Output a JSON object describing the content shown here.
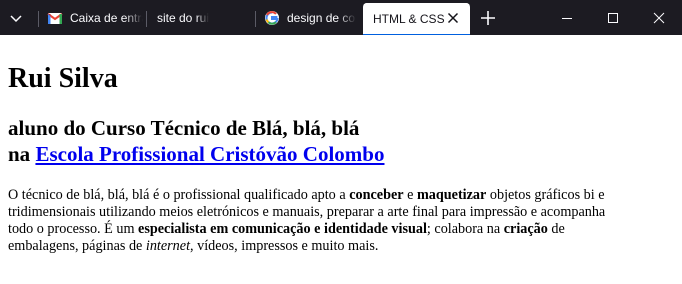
{
  "tabs": [
    {
      "label": "Caixa de entrada",
      "icon": "gmail-icon",
      "active": false
    },
    {
      "label": "site do rui",
      "icon": "",
      "active": false
    },
    {
      "label": "design de comunicação",
      "icon": "google-icon",
      "active": false
    },
    {
      "label": "HTML & CSS",
      "icon": "",
      "active": true
    }
  ],
  "colors": {
    "titlebar_bg": "#1c1b22",
    "link": "#0000ee"
  },
  "page": {
    "h1": "Rui Silva",
    "h2_line1": "aluno do Curso Técnico de Blá, blá, blá",
    "h2_prefix": "na",
    "h2_link": "Escola Profissional Cristóvão Colombo",
    "paragraph": {
      "t1": "O técnico de blá, blá, blá é o profissional qualificado apto a ",
      "b1": "conceber",
      "t2": " e ",
      "b2": "maquetizar",
      "t3": " objetos gráficos bi e",
      "t4": "tridimensionais utilizando meios eletrónicos e manuais, preparar a arte final para impressão e acompanha",
      "t5": "todo o processo. É um ",
      "b3": "especialista em comunicação e identidade visual",
      "t6": "; colabora na ",
      "b4": "criação",
      "t7": " de",
      "t8": "embalagens, páginas de ",
      "i1": "internet",
      "t9": ", vídeos, impressos e muito mais."
    }
  }
}
